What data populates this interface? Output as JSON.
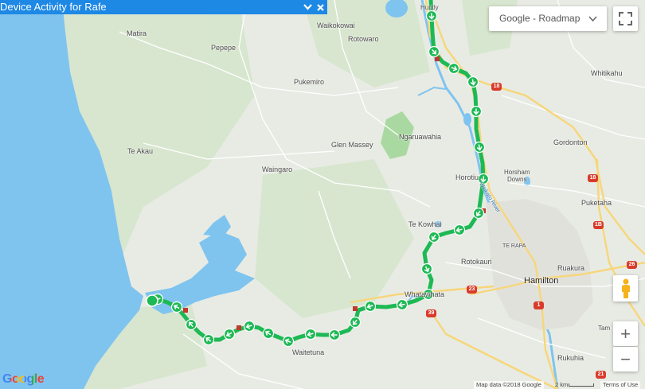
{
  "panel": {
    "title": "Device Activity for Rafe"
  },
  "map_type": {
    "selected": "Google - Roadmap"
  },
  "places": {
    "matira": "Matira",
    "waikokowai": "Waikokowai",
    "rotowaro": "Rotowaro",
    "pepepe": "Pepepe",
    "pukemiro": "Pukemiro",
    "ngaruawahia": "Ngaruawahia",
    "glen_massey": "Glen Massey",
    "te_akau": "Te Akau",
    "waingaro": "Waingaro",
    "horotiu": "Horotiu",
    "horsham_downs": "Horsham\nDowns",
    "whitikahu": "Whitikahu",
    "gordonton": "Gordonton",
    "puketaha": "Puketaha",
    "te_kowhai": "Te Kowhai",
    "te_rapa": "TE RAPA",
    "rotokauri": "Rotokauri",
    "ruakura": "Ruakura",
    "hamilton": "Hamilton",
    "whatawhata": "Whatawhata",
    "waitetuna": "Waitetuna",
    "rukuhia": "Rukuhia",
    "huntly": "Huntly",
    "waikato_river": "Waikato River",
    "tam": "Tam"
  },
  "highways": [
    "18",
    "1B",
    "23",
    "39",
    "1",
    "26",
    "21"
  ],
  "controls": {
    "zoom_in": "+",
    "zoom_out": "−"
  },
  "icons": [
    "chevron-down-icon",
    "close-icon",
    "fullscreen-icon",
    "pegman-icon",
    "direction-arrow-icon",
    "stop-marker-icon"
  ],
  "footer": {
    "logo": "Google",
    "map_data": "Map data ©2018 Google",
    "scale": "2 km",
    "terms": "Terms of Use"
  },
  "colors": {
    "route": "#1db954",
    "header": "#1e88e5",
    "water": "#7fc4ee",
    "land": "#e8ebe4",
    "green_area": "#cfe3c3",
    "major_road": "#f7d67a",
    "highway_shield": "#d93b2b"
  }
}
